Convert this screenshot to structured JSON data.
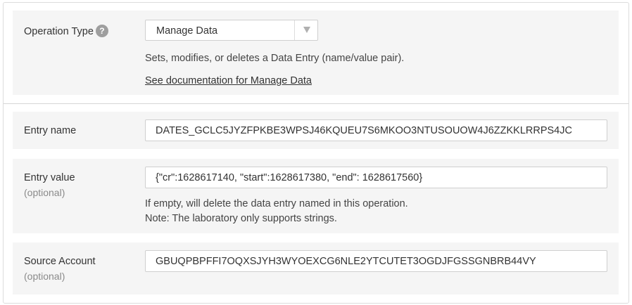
{
  "operation": {
    "label": "Operation Type",
    "help_icon": "question-circle-icon",
    "selected_value": "Manage Data",
    "description": "Sets, modifies, or deletes a Data Entry (name/value pair).",
    "doc_link": "See documentation for Manage Data"
  },
  "entry_name": {
    "label": "Entry name",
    "value": "DATES_GCLC5JYZFPKBE3WPSJ46KQUEU7S6MKOO3NTUSOUOW4J6ZZKKLRRPS4JC"
  },
  "entry_value": {
    "label": "Entry value",
    "sublabel": "(optional)",
    "value": "{\"cr\":1628617140, \"start\":1628617380, \"end\": 1628617560}",
    "note_line1": "If empty, will delete the data entry named in this operation.",
    "note_line2": "Note: The laboratory only supports strings."
  },
  "source_account": {
    "label": "Source Account",
    "sublabel": "(optional)",
    "value": "GBUQPBPFFI7OQXSJYH3WYOEXCG6NLE2YTCUTET3OGDJFGSSGNBRB44VY"
  }
}
